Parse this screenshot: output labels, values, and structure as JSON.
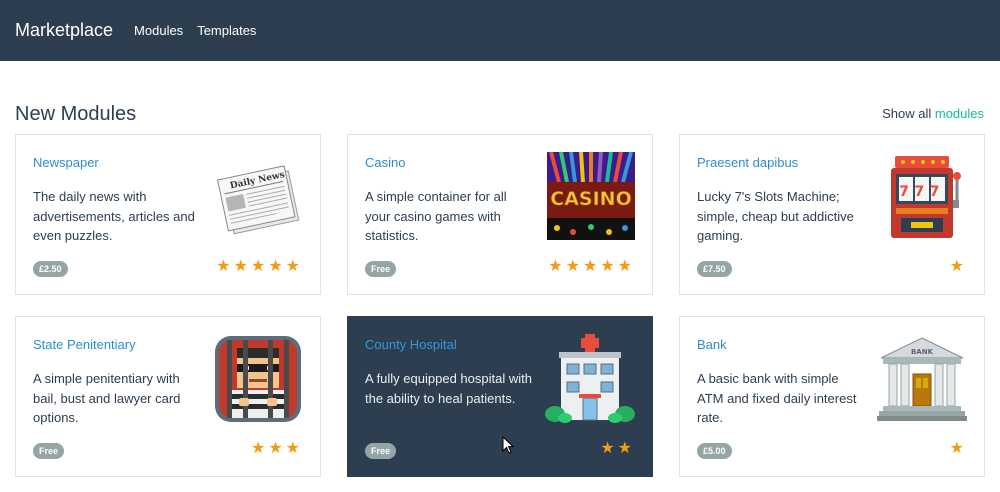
{
  "navbar": {
    "brand": "Marketplace",
    "links": [
      "Modules",
      "Templates"
    ]
  },
  "section": {
    "title": "New Modules",
    "show_all_prefix": "Show all",
    "show_all_link": "modules"
  },
  "colors": {
    "navbar": "#2c3e50",
    "accent": "#18bc9c",
    "link": "#2a8fd0",
    "star": "#f39c12",
    "badge": "#95a5a6"
  },
  "cards": [
    {
      "title": "Newspaper",
      "description": "The daily news with advertisements, articles and even puzzles.",
      "price": "£2.50",
      "rating": 5,
      "icon": "newspaper-icon",
      "image_text": "Daily News"
    },
    {
      "title": "Casino",
      "description": "A simple container for all your casino games with statistics.",
      "price": "Free",
      "rating": 5,
      "icon": "casino-icon",
      "image_text": "CASINO"
    },
    {
      "title": "Praesent dapibus",
      "description": "Lucky 7's Slots Machine; simple, cheap but addictive gaming.",
      "price": "£7.50",
      "rating": 1,
      "icon": "slot-machine-icon",
      "image_text": "777"
    },
    {
      "title": "State Penitentiary",
      "description": "A simple penitentiary with bail, bust and lawyer card options.",
      "price": "Free",
      "rating": 3,
      "icon": "prisoner-icon"
    },
    {
      "title": "County Hospital",
      "description": "A fully equipped hospital with the ability to heal patients.",
      "price": "Free",
      "rating": 2,
      "icon": "hospital-icon",
      "highlighted": true
    },
    {
      "title": "Bank",
      "description": "A basic bank with simple ATM and fixed daily interest rate.",
      "price": "£5.00",
      "rating": 1,
      "icon": "bank-icon",
      "image_text": "BANK"
    }
  ]
}
